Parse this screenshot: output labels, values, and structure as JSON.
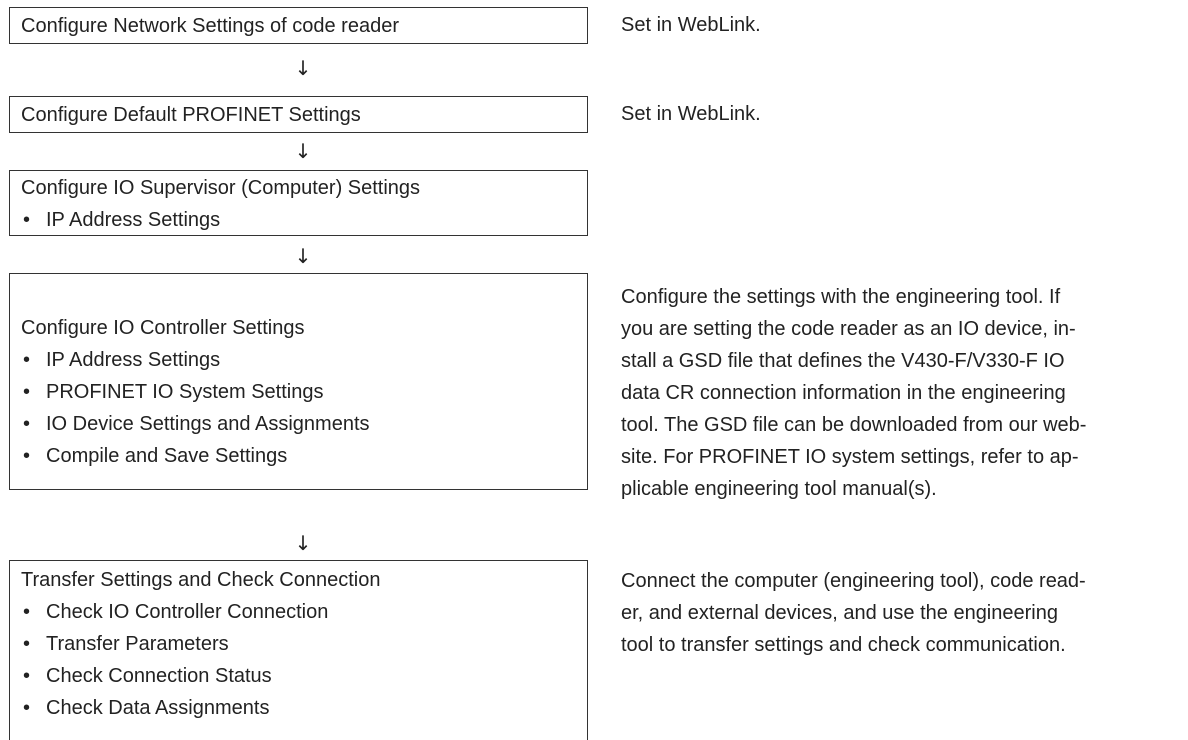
{
  "steps": [
    {
      "title": "Configure Network Settings of code reader",
      "items": [],
      "note": "Set in WebLink."
    },
    {
      "title": "Configure Default PROFINET Settings",
      "items": [],
      "note": "Set in WebLink."
    },
    {
      "title": "Configure IO Supervisor (Computer) Settings",
      "items": [
        "IP Address Settings"
      ],
      "note": ""
    },
    {
      "title": "Configure IO Controller Settings",
      "items": [
        "IP Address Settings",
        "PROFINET IO System Settings",
        "IO Device Settings and Assignments",
        "Compile and Save Settings"
      ],
      "note_lines": [
        "Configure the settings with the engineering tool. If",
        "you are setting the code reader as an IO device, in-",
        "stall a GSD file that defines the V430-F/V330-F IO",
        "data CR connection information in the engineering",
        "tool. The GSD file can be downloaded from our web-",
        "site. For PROFINET IO system settings, refer to ap-",
        "plicable engineering tool manual(s)."
      ]
    },
    {
      "title": "Transfer Settings and Check Connection",
      "items": [
        "Check IO Controller Connection",
        "Transfer Parameters",
        "Check Connection Status",
        "Check Data Assignments"
      ],
      "note_lines": [
        "Connect the computer (engineering tool), code read-",
        "er, and external devices, and use the engineering",
        "tool to transfer settings and check communication."
      ]
    }
  ],
  "arrow_glyph": "↓",
  "bullet_glyph": "•"
}
